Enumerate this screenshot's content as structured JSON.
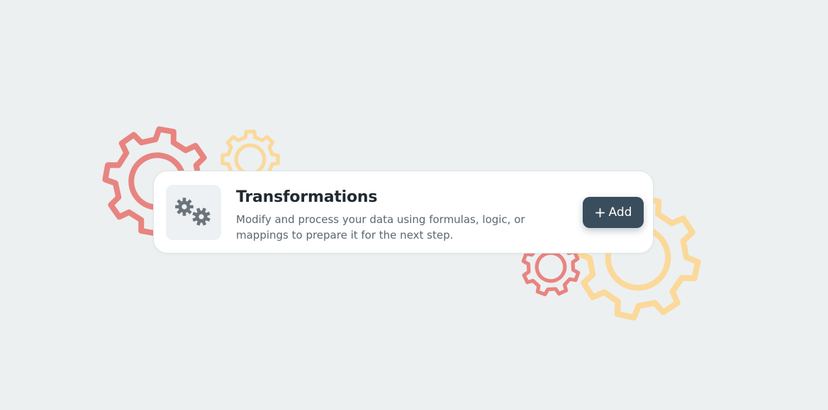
{
  "card": {
    "title": "Transformations",
    "description": "Modify and process your data using formulas, logic, or mappings to prepare it for the next step.",
    "icon": "gears-icon",
    "add_button": {
      "label": "Add",
      "icon": "plus-icon"
    }
  },
  "decorations": {
    "background_icons": [
      "gear-icon",
      "gear-icon",
      "gear-icon",
      "gear-icon"
    ]
  },
  "colors": {
    "background": "#edf0f1",
    "card_background": "#ffffff",
    "gear_red": "#e88480",
    "gear_yellow": "#fad99a",
    "button_background": "#3a4d5c",
    "title_text": "#1f2a33",
    "description_text": "#5a6670",
    "icon_gray": "#6b747c"
  }
}
